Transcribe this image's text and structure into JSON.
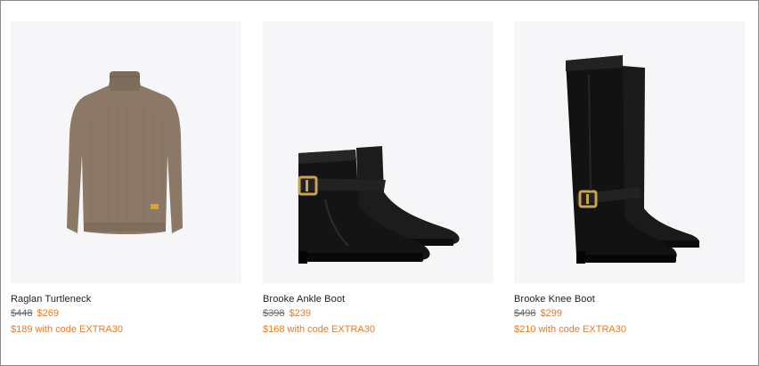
{
  "products": [
    {
      "name": "Raglan Turtleneck",
      "original_price": "$448",
      "sale_price": "$269",
      "promo": "$189 with code EXTRA30",
      "image": "sweater-image"
    },
    {
      "name": "Brooke Ankle Boot",
      "original_price": "$398",
      "sale_price": "$239",
      "promo": "$168 with code EXTRA30",
      "image": "ankle-boot-image"
    },
    {
      "name": "Brooke Knee Boot",
      "original_price": "$498",
      "sale_price": "$299",
      "promo": "$210 with code EXTRA30",
      "image": "knee-boot-image"
    }
  ],
  "colors": {
    "image_bg": "#f6f6f8",
    "sale": "#e8782a",
    "strike": "#6b6b6b",
    "text": "#1f1f1f"
  }
}
